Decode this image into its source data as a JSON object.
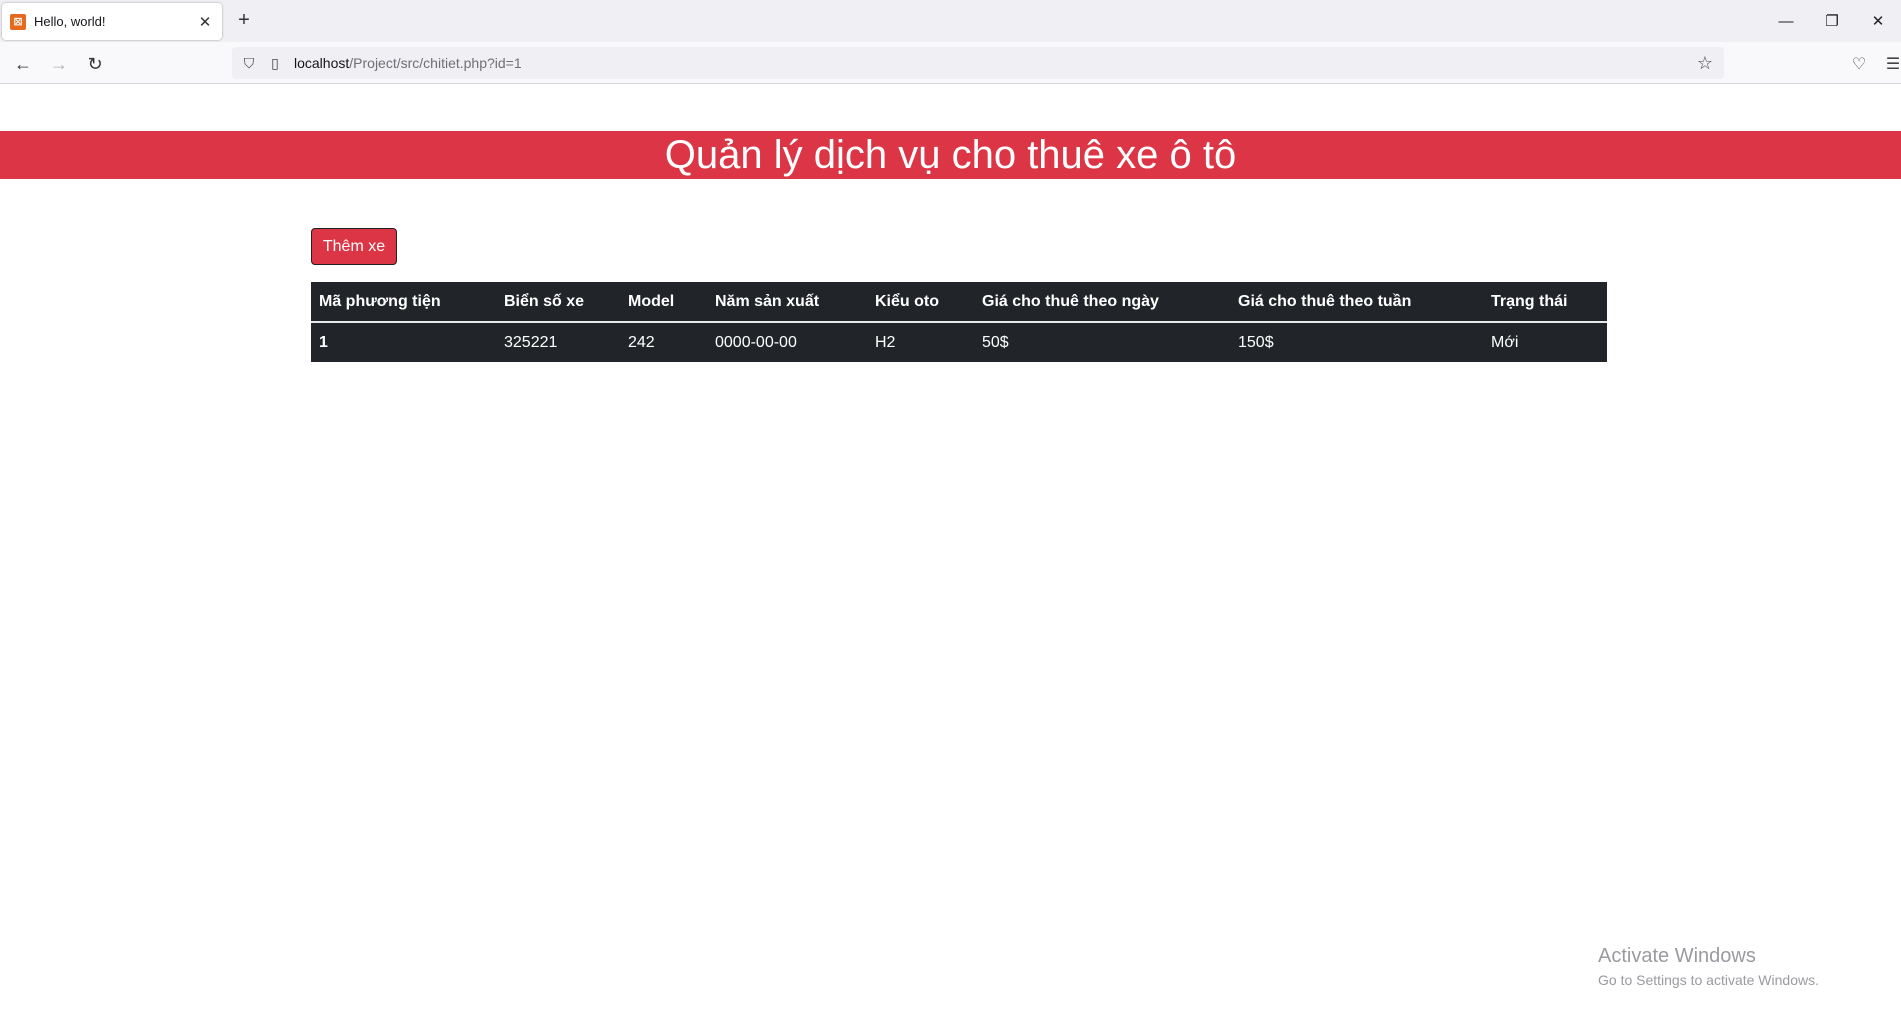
{
  "browser": {
    "tab_title": "Hello, world!",
    "url_host": "localhost",
    "url_path": "/Project/src/chitiet.php?id=1",
    "icons": {
      "favicon": "xampp-icon",
      "close": "close-icon",
      "new_tab": "plus-icon",
      "back": "back-arrow-icon",
      "forward": "forward-arrow-icon",
      "reload": "reload-icon",
      "shield": "shield-icon",
      "page": "page-icon",
      "bookmark": "star-icon",
      "pocket": "pocket-icon",
      "menu": "hamburger-menu-icon"
    }
  },
  "page": {
    "title": "Quản lý dịch vụ cho thuê xe ô tô",
    "add_button_label": "Thêm xe",
    "accent_color": "#dc3545",
    "table_color": "#212529",
    "table": {
      "headers": [
        "Mã phương tiện",
        "Biển số xe",
        "Model",
        "Năm sản xuất",
        "Kiểu oto",
        "Giá cho thuê theo ngày",
        "Giá cho thuê theo tuần",
        "Trạng thái"
      ],
      "rows": [
        [
          "1",
          "325221",
          "242",
          "0000-00-00",
          "H2",
          "50$",
          "150$",
          "Mới"
        ]
      ]
    }
  },
  "os_watermark": {
    "title": "Activate Windows",
    "subtitle": "Go to Settings to activate Windows."
  }
}
